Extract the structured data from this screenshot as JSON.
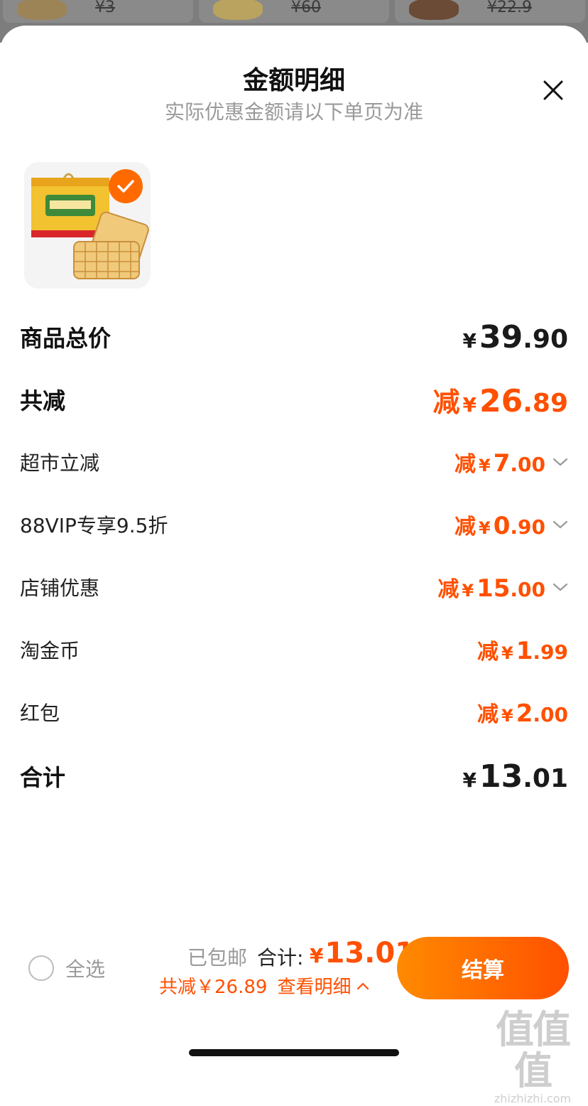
{
  "background": {
    "prices": [
      "¥3",
      "¥60",
      "¥22.9"
    ]
  },
  "sheet": {
    "title": "金额明细",
    "subtitle": "实际优惠金额请以下单页为准",
    "close_icon": "close-icon"
  },
  "product": {
    "selected": true,
    "image": "waffle-gift-box"
  },
  "rows": {
    "total_price": {
      "label": "商品总价",
      "currency": "¥",
      "int": "39",
      "dec": ".90"
    },
    "total_discount": {
      "label": "共减",
      "prefix": "减",
      "currency": "¥",
      "int": "26",
      "dec": ".89"
    },
    "supermarket": {
      "label": "超市立减",
      "prefix": "减",
      "currency": "¥",
      "int": "7",
      "dec": ".00"
    },
    "vip": {
      "label": "88VIP专享9.5折",
      "prefix": "减",
      "currency": "¥",
      "int": "0",
      "dec": ".90"
    },
    "store": {
      "label": "店铺优惠",
      "prefix": "减",
      "currency": "¥",
      "int": "15",
      "dec": ".00"
    },
    "coins": {
      "label": "淘金币",
      "prefix": "减",
      "currency": "¥",
      "int": "1",
      "dec": ".99"
    },
    "redpacket": {
      "label": "红包",
      "prefix": "减",
      "currency": "¥",
      "int": "2",
      "dec": ".00"
    },
    "subtotal": {
      "label": "合计",
      "currency": "¥",
      "int": "13",
      "dec": ".01"
    }
  },
  "bottom_bar": {
    "select_all": "全选",
    "shipping": "已包邮",
    "total_label": "合计:",
    "total_currency": "¥",
    "total_value": "13.01",
    "saved_text": "共减￥26.89",
    "detail_link": "查看明细",
    "checkout_label": "结算"
  },
  "watermark": {
    "big": "值值值",
    "small": "zhizhizhi.com"
  },
  "colors": {
    "accent": "#ff5000",
    "accent_light": "#ff8a00"
  }
}
